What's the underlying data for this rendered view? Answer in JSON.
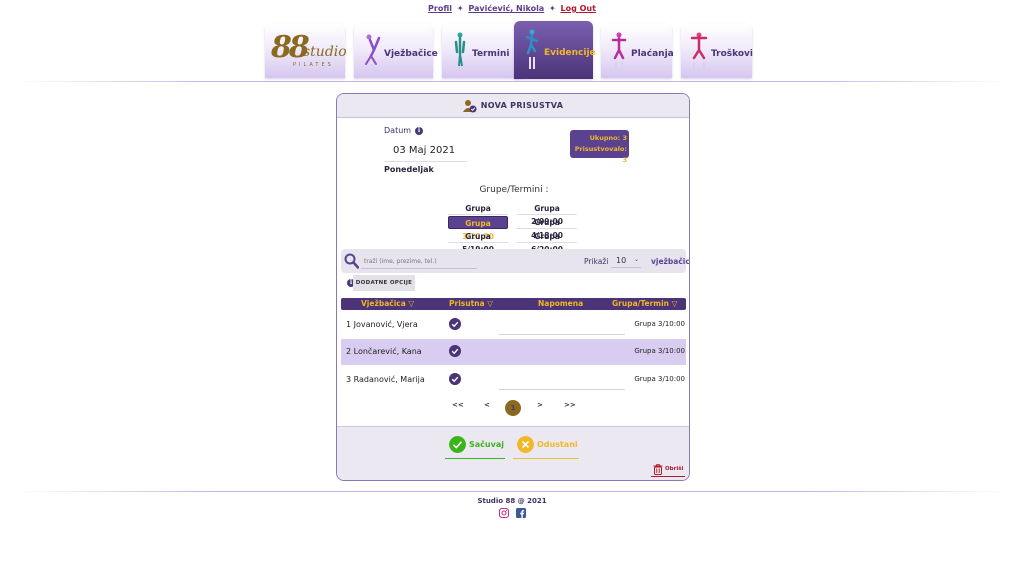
{
  "top_links": {
    "profile": "Profil",
    "user": "Pavićević, Nikola",
    "logout": "Log Out",
    "separator": "✦"
  },
  "nav": {
    "logo_main": "88",
    "logo_script": "studio",
    "logo_sub": "PILATES",
    "items": [
      {
        "label": "Vježbačice",
        "active": false
      },
      {
        "label": "Termini",
        "active": false
      },
      {
        "label": "Evidencije",
        "active": true
      },
      {
        "label": "Plaćanja",
        "active": false
      },
      {
        "label": "Troškovi",
        "active": false
      }
    ]
  },
  "card": {
    "title": "NOVA PRISUSTVA",
    "date_label": "Datum",
    "date_value": "03 Maj 2021",
    "weekday": "Ponedeljak",
    "totals": {
      "ukupno": "Ukupno: 3",
      "prisustvovalo": "Prisustvovalo: 3"
    },
    "groups_title": "Grupe/Termini :",
    "groups": [
      {
        "label": "Grupa 1/08:00",
        "selected": false
      },
      {
        "label": "Grupa 2/09:00",
        "selected": false
      },
      {
        "label": "Grupa 3/10:00",
        "selected": true
      },
      {
        "label": "Grupa 4/18:00",
        "selected": false
      },
      {
        "label": "Grupa 5/19:00",
        "selected": false
      },
      {
        "label": "Grupa 6/20:00",
        "selected": false
      }
    ],
    "search_placeholder": "traži (ime, prezime, tel.)",
    "show_label": "Prikaži",
    "page_size": "10",
    "show_suffix": "vježbačica",
    "extra_options": "DODATNE OPCIJE",
    "table": {
      "headers": [
        "Vježbačica",
        "Prisutna",
        "Napomena",
        "Grupa/Termin"
      ],
      "rows": [
        {
          "name": "1 Jovanović, Vjera",
          "present": true,
          "note": "",
          "group": "Grupa 3/10:00"
        },
        {
          "name": "2 Lončarević, Kana",
          "present": true,
          "note": "",
          "group": "Grupa 3/10:00"
        },
        {
          "name": "3 Radanović, Marija",
          "present": true,
          "note": "",
          "group": "Grupa 3/10:00"
        }
      ]
    },
    "pager": {
      "first": "<<",
      "prev": "<",
      "current": "1",
      "next": ">",
      "last": ">>"
    },
    "save_label": "Sačuvaj",
    "cancel_label": "Odustani",
    "delete_label": "Obriši"
  },
  "footer": {
    "copyright": "Studio 88 @ 2021"
  },
  "colors": {
    "primary": "#4b3478",
    "accent": "#f2b728",
    "light": "#d8cdf0",
    "save": "#3ab41b",
    "cancel": "#f2b728",
    "danger": "#b0182b"
  }
}
